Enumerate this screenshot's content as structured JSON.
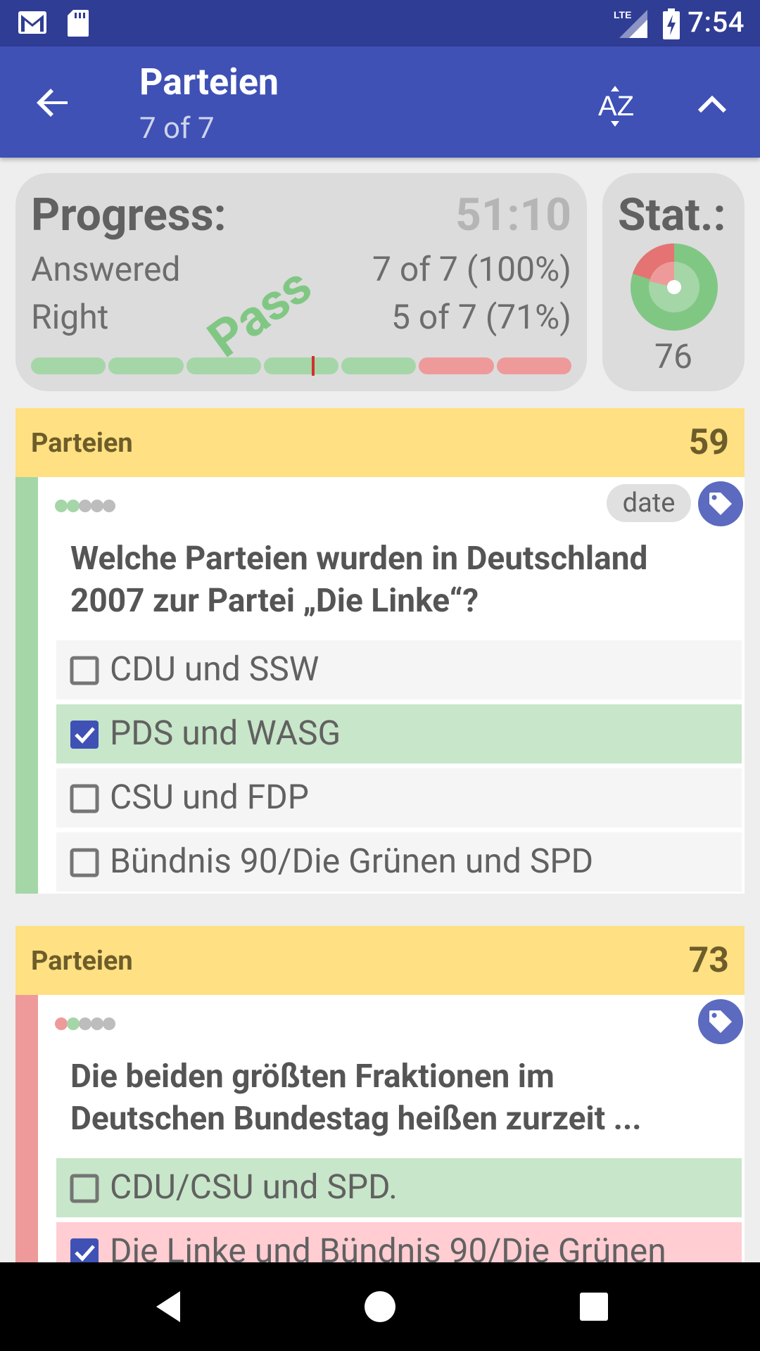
{
  "status_bar": {
    "time": "7:54",
    "icons": [
      "gmail-icon",
      "sd-card-icon",
      "lte-signal-icon",
      "battery-charging-icon"
    ],
    "lte_label": "LTE"
  },
  "app_bar": {
    "title": "Parteien",
    "subtitle": "7 of 7",
    "back_icon": "arrow-back-icon",
    "sort_icon": "sort-az-icon",
    "collapse_icon": "chevron-up-icon",
    "sort_label": "AZ"
  },
  "progress": {
    "title": "Progress:",
    "timer": "51:10",
    "answered_label": "Answered",
    "answered_value": "7 of 7 (100%)",
    "right_label": "Right",
    "right_value": "5 of 7 (71%)",
    "stamp": "Pass",
    "segments": [
      "right",
      "right",
      "right",
      "right",
      "right",
      "wrong",
      "wrong"
    ],
    "pass_threshold": 0.52
  },
  "stat": {
    "title": "Stat.:",
    "value": "76"
  },
  "colors": {
    "primary": "#3f51b5",
    "primary_dark": "#2f3d95",
    "header_yellow": "#ffe082",
    "right_green": "#a5d6a7",
    "wrong_red": "#ef9a9a",
    "correct_bg": "#c8e6c9",
    "wrong_bg": "#ffcdd2",
    "accent": "#5c6bc0"
  },
  "questions": [
    {
      "category": "Parteien",
      "number": "59",
      "result": "right",
      "history": [
        "green",
        "green",
        "grey",
        "grey",
        "grey"
      ],
      "tag": "date",
      "text_line1": "Welche Parteien wurden in Deutschland",
      "text_line2": "2007 zur Partei „Die Linke“?",
      "answers": [
        {
          "text": "CDU und SSW",
          "checked": false,
          "state": "neutral"
        },
        {
          "text": "PDS und WASG",
          "checked": true,
          "state": "correct"
        },
        {
          "text": "CSU und FDP",
          "checked": false,
          "state": "neutral"
        },
        {
          "text": "Bündnis 90/Die Grünen und SPD",
          "checked": false,
          "state": "neutral"
        }
      ]
    },
    {
      "category": "Parteien",
      "number": "73",
      "result": "wrong",
      "history": [
        "red",
        "green",
        "grey",
        "grey",
        "grey"
      ],
      "text_line1": "Die beiden größten Fraktionen im",
      "text_line2": "Deutschen Bundestag heißen zurzeit ...",
      "answers": [
        {
          "text": "CDU/CSU und SPD.",
          "checked": false,
          "state": "correct"
        },
        {
          "text": "Die Linke und Bündnis 90/Die Grünen",
          "checked": true,
          "state": "wrong"
        }
      ]
    }
  ],
  "nav_bar": {
    "icons": [
      "back-triangle-icon",
      "home-circle-icon",
      "recents-square-icon"
    ]
  }
}
